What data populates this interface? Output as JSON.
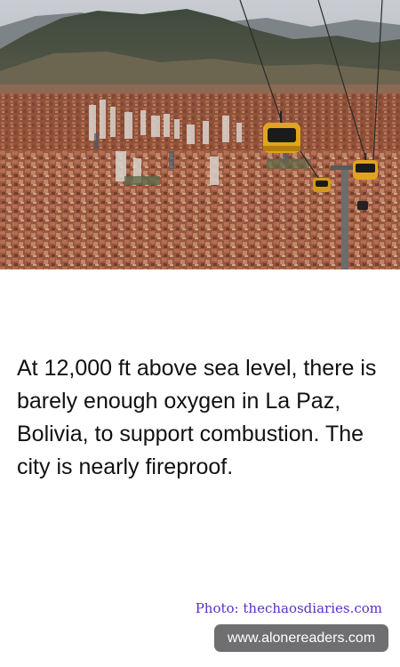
{
  "photo": {
    "subject": "La Paz cityscape with cable cars"
  },
  "fact": {
    "text": "At 12,000 ft above sea level, there is barely enough oxygen in La Paz, Bolivia, to support combustion. The city is nearly fireproof."
  },
  "credit": {
    "text": "Photo: thechaosdiaries.com",
    "color": "#5b2fc7"
  },
  "badge": {
    "text": "www.alonereaders.com",
    "background": "#6f6f72"
  }
}
